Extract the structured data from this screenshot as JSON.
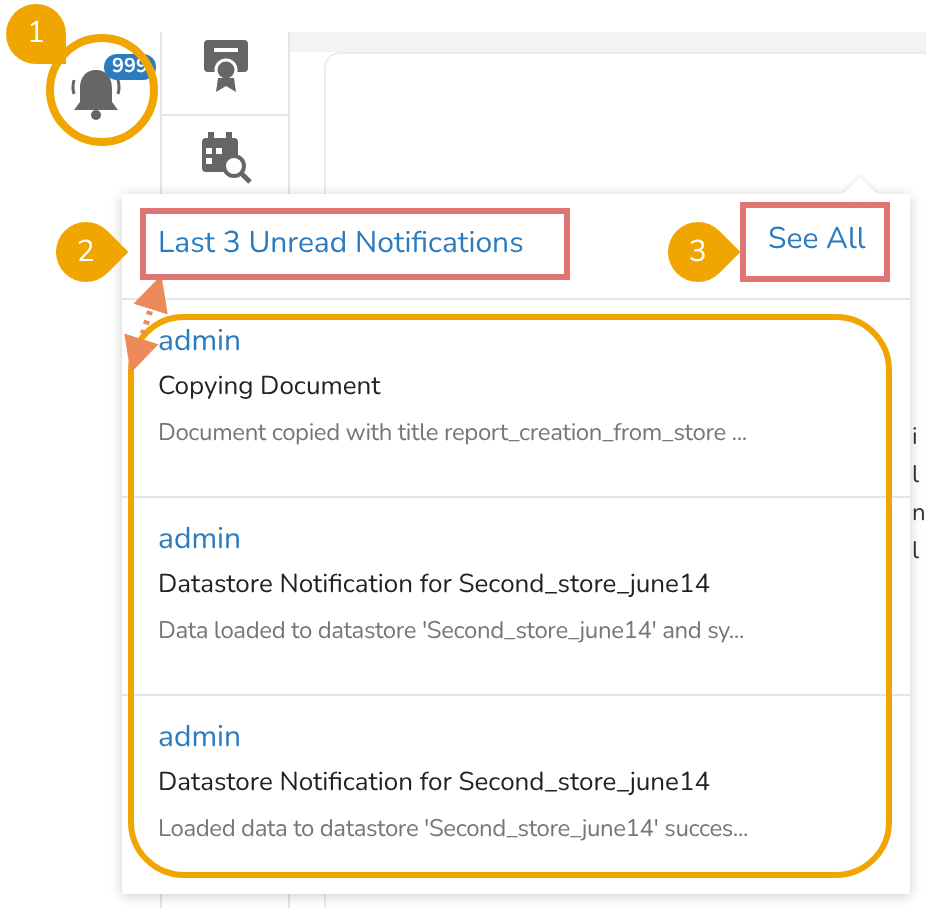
{
  "sidebar": {
    "notification_badge": "999"
  },
  "annotations": [
    {
      "number": "1"
    },
    {
      "number": "2"
    },
    {
      "number": "3"
    }
  ],
  "notifications_popup": {
    "title": "Last 3 Unread Notifications",
    "see_all": "See All",
    "items": [
      {
        "sender": "admin",
        "title": "Copying Document",
        "message": "Document copied with title report_creation_from_store ..."
      },
      {
        "sender": "admin",
        "title": "Datastore Notification for Second_store_june14",
        "message": "Data loaded to datastore 'Second_store_june14' and sy..."
      },
      {
        "sender": "admin",
        "title": "Datastore Notification for Second_store_june14",
        "message": "Loaded data to datastore 'Second_store_june14' succes..."
      }
    ]
  },
  "background_text": [
    "i",
    "l",
    "n",
    "l"
  ]
}
